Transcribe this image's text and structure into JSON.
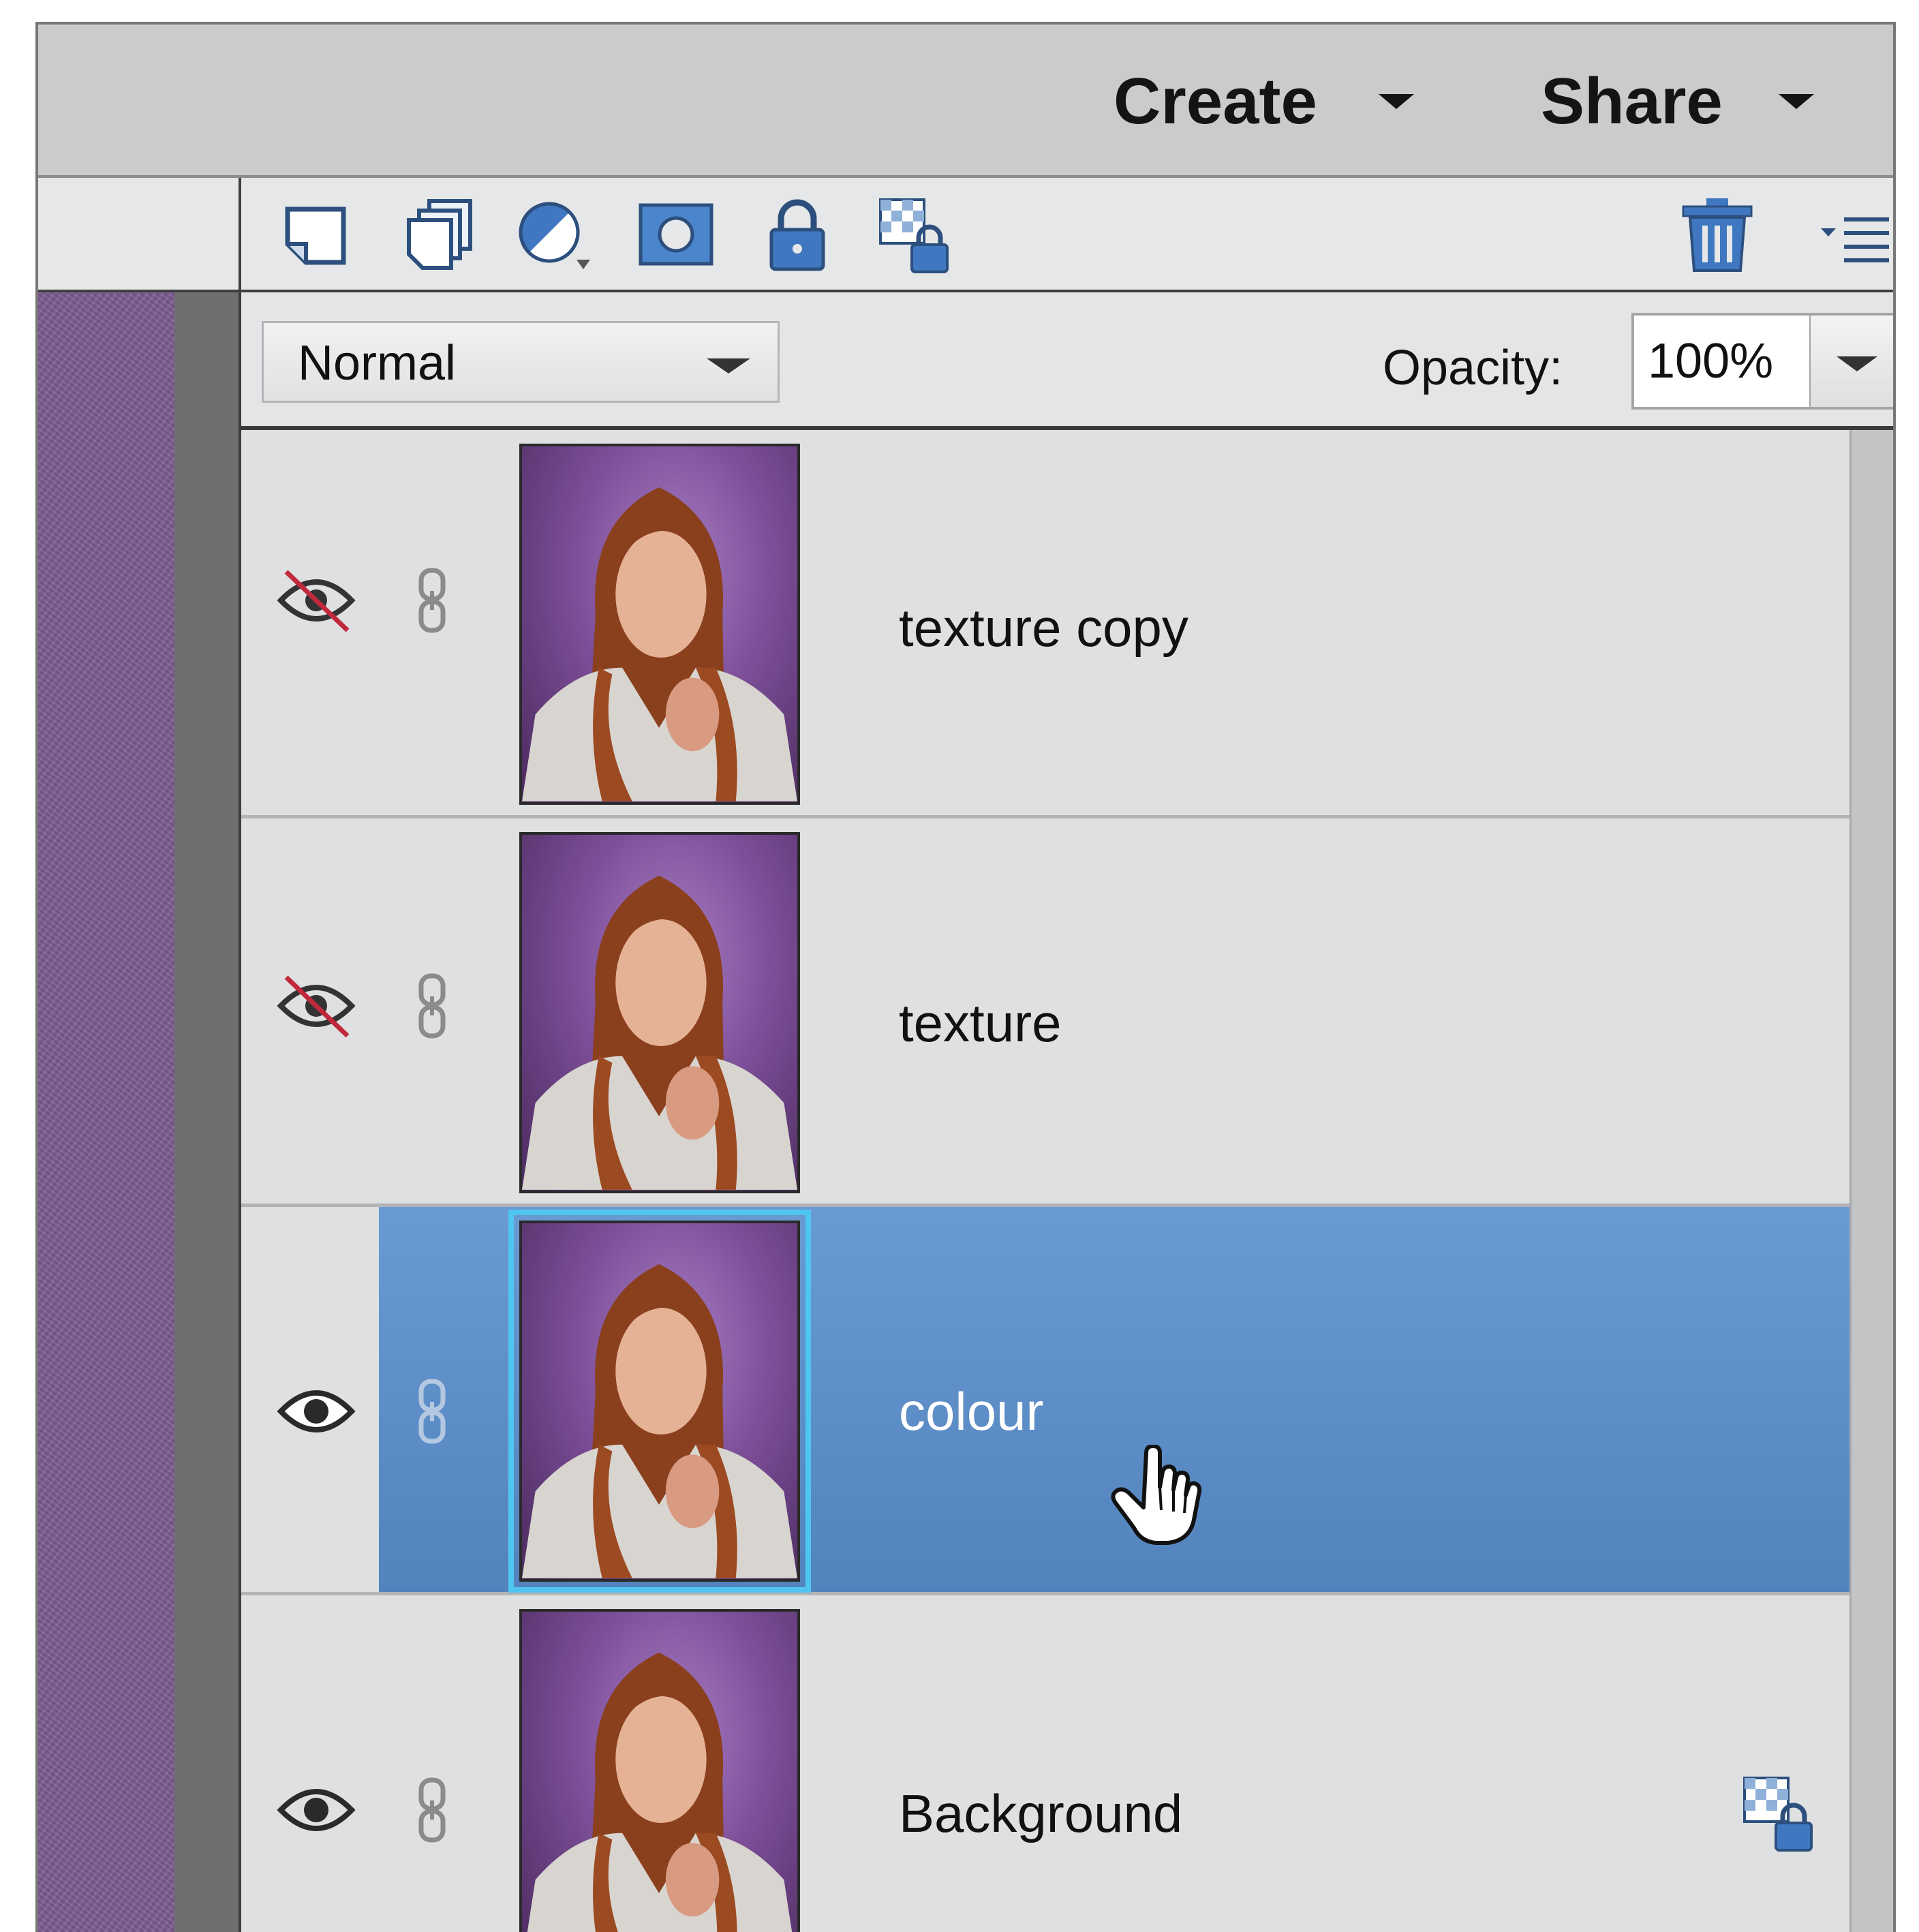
{
  "topbar": {
    "create_label": "Create",
    "share_label": "Share"
  },
  "toolbar": {
    "icons": [
      "new-layer-icon",
      "new-group-icon",
      "adjustment-layer-icon",
      "layer-mask-icon",
      "lock-all-icon",
      "lock-transparency-icon",
      "trash-icon",
      "panel-menu-icon"
    ]
  },
  "blend": {
    "mode": "Normal",
    "opacity_label": "Opacity:",
    "opacity_value": "100%"
  },
  "layers": [
    {
      "name": "texture copy",
      "visible": false,
      "selected": false,
      "locked": false
    },
    {
      "name": "texture",
      "visible": false,
      "selected": false,
      "locked": false
    },
    {
      "name": "colour",
      "visible": true,
      "selected": true,
      "locked": false
    },
    {
      "name": "Background",
      "visible": true,
      "selected": false,
      "locked": true
    }
  ],
  "colors": {
    "selection": "#5f8fca",
    "selected_thumb_outline": "#4fc6f0",
    "hidden_eye_slash": "#c0283c",
    "icon_blue": "#3f78c0"
  }
}
